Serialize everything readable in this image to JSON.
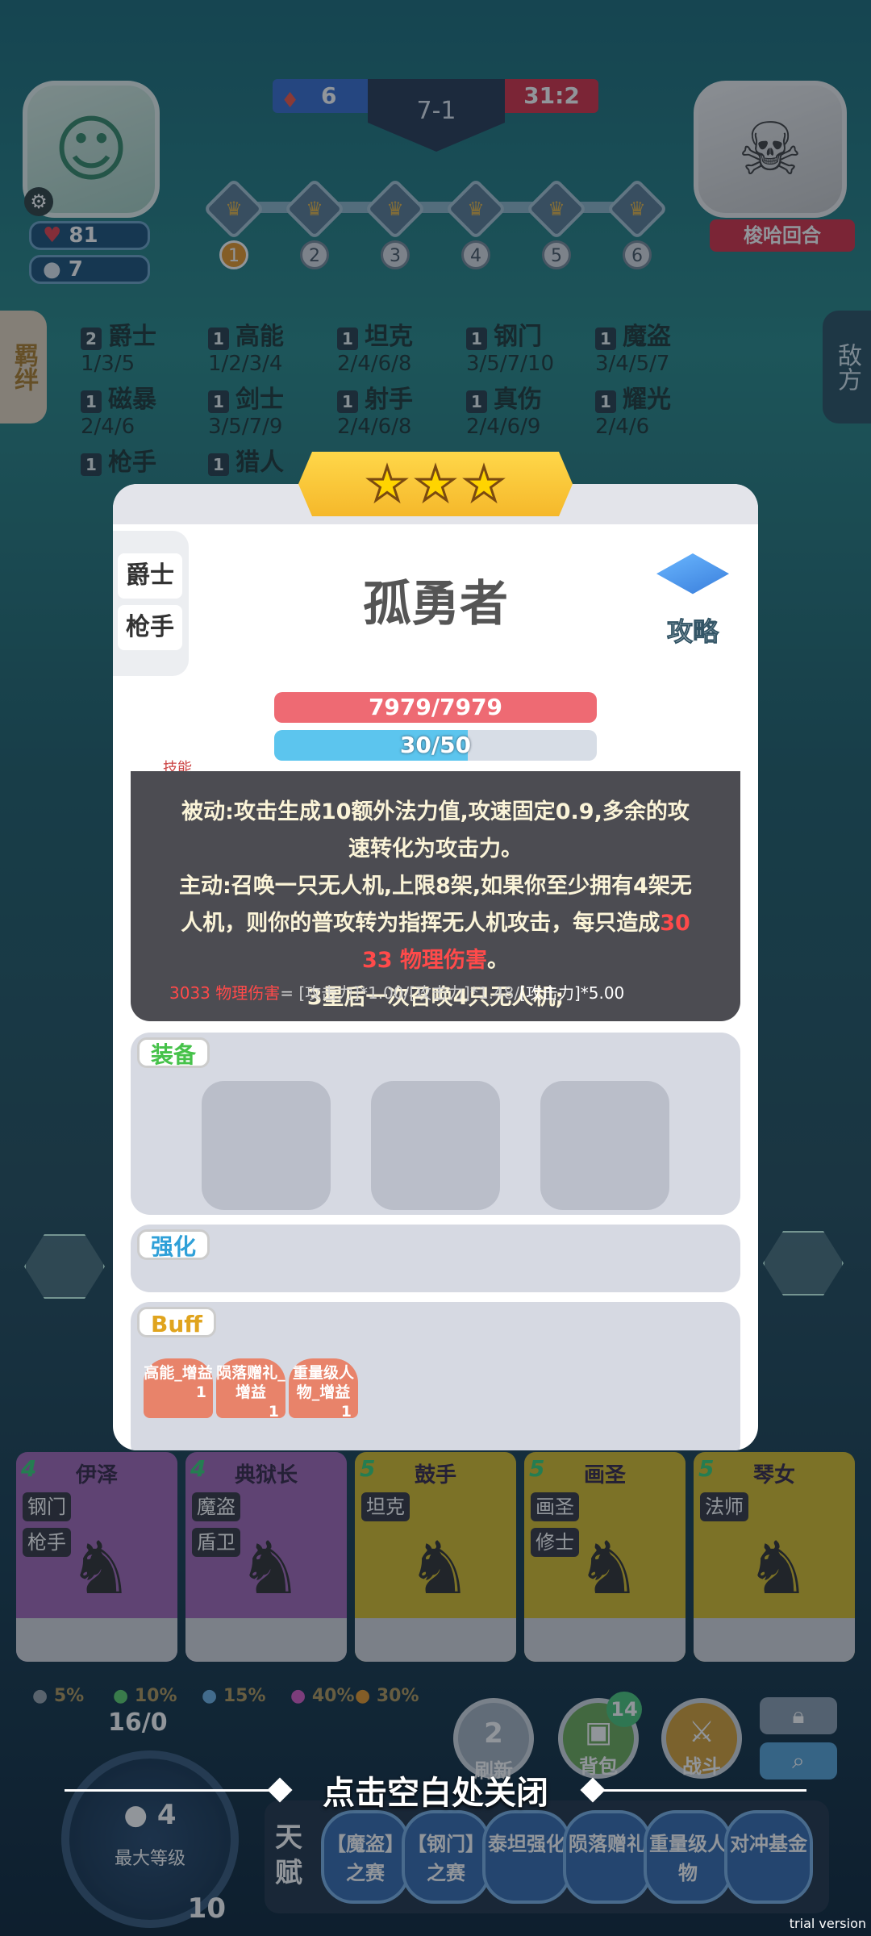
{
  "hud": {
    "hearts": "81",
    "coins": "7",
    "blue_score": "6",
    "stage": "7-1",
    "red_score": "31:2",
    "enemy_round": "梭哈回合",
    "rounds": [
      "1",
      "2",
      "3",
      "4",
      "5",
      "6"
    ]
  },
  "synergy": {
    "tab_label": "羁绊",
    "enemy_tab_label": "敌方",
    "items": [
      {
        "count": "2",
        "name": "爵士",
        "tiers": "1/3/5"
      },
      {
        "count": "1",
        "name": "高能",
        "tiers": "1/2/3/4"
      },
      {
        "count": "1",
        "name": "坦克",
        "tiers": "2/4/6/8"
      },
      {
        "count": "1",
        "name": "钢门",
        "tiers": "3/5/7/10"
      },
      {
        "count": "1",
        "name": "魔盗",
        "tiers": "3/4/5/7"
      },
      {
        "count": "1",
        "name": "磁暴",
        "tiers": "2/4/6"
      },
      {
        "count": "1",
        "name": "剑士",
        "tiers": "3/5/7/9"
      },
      {
        "count": "1",
        "name": "射手",
        "tiers": "2/4/6/8"
      },
      {
        "count": "1",
        "name": "真伤",
        "tiers": "2/4/6/9"
      },
      {
        "count": "1",
        "name": "耀光",
        "tiers": "2/4/6"
      },
      {
        "count": "1",
        "name": "枪手",
        "tiers": ""
      },
      {
        "count": "1",
        "name": "猎人",
        "tiers": ""
      }
    ]
  },
  "modal": {
    "traits": [
      "爵士",
      "枪手"
    ],
    "hero_name": "孤勇者",
    "strategy_label": "攻略",
    "hp": "7979/7979",
    "mana": "30/50",
    "mana_fraction": 0.6,
    "skill_tab": "技能",
    "skill_lines": [
      "被动:攻击生成10额外法力值,攻速固定0.9,多余的攻",
      "速转化为攻击力。",
      "主动:召唤一只无人机,上限8架,如果你至少拥有4架无",
      "人机，则你的普攻转为指挥无人机攻击，每只造成"
    ],
    "skill_dmg_a": "30",
    "skill_dmg_b": "33 物理伤害",
    "skill_line_end": "。",
    "skill_line_star": "3星后一次召唤4只无人机;",
    "formula_red": "3033 物理伤害",
    "formula_mid": "= [攻击力]*1.00/[攻击力]*1.48/",
    "formula_white": "[攻击力]*5.00",
    "equip_label": "装备",
    "enhance_label": "强化",
    "buff_label": "Buff",
    "buffs": [
      {
        "name": "高能_增益",
        "count": "1"
      },
      {
        "name": "陨落赠礼_增益",
        "count": "1"
      },
      {
        "name": "重量级人物_增益",
        "count": "1"
      }
    ]
  },
  "shop": [
    {
      "cost": "4",
      "name": "伊泽",
      "traits": [
        "钢门",
        "枪手"
      ]
    },
    {
      "cost": "4",
      "name": "典狱长",
      "traits": [
        "魔盗",
        "盾卫"
      ]
    },
    {
      "cost": "5",
      "name": "鼓手",
      "traits": [
        "坦克"
      ]
    },
    {
      "cost": "5",
      "name": "画圣",
      "traits": [
        "画圣",
        "修士"
      ]
    },
    {
      "cost": "5",
      "name": "琴女",
      "traits": [
        "法师"
      ]
    }
  ],
  "odds": [
    "5%",
    "10%",
    "15%",
    "40%",
    "30%"
  ],
  "bottom": {
    "xp": "16/0",
    "level_coins": "4",
    "level_label": "最大等级",
    "level_num": "10",
    "refresh_cost": "2",
    "refresh_label": "刷新",
    "bag_label": "背包",
    "bag_count": "14",
    "fight_label": "战斗",
    "talent_label": "天赋",
    "talents": [
      "【魔盗】之赛",
      "【钢门】之赛",
      "泰坦强化",
      "陨落赠礼",
      "重量级人物",
      "对冲基金"
    ]
  },
  "close_hint": "点击空白处关闭",
  "trial": "trial version",
  "colors": {
    "accent": "#f5b82b",
    "hp": "#ee6a73",
    "mana": "#5cc5ee",
    "panel": "#d6d9e2"
  }
}
